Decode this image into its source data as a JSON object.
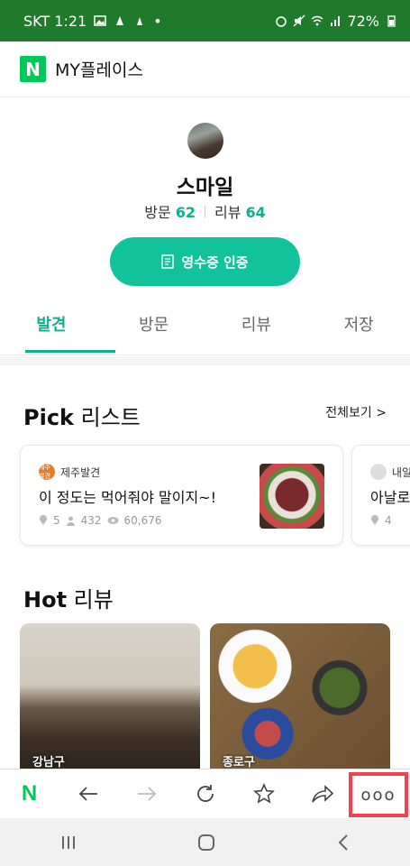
{
  "status_bar": {
    "carrier_time": "SKT 1:21",
    "battery": "72%"
  },
  "header": {
    "logo": "N",
    "title": "MY플레이스"
  },
  "profile": {
    "name": "스마일",
    "visits_label": "방문",
    "visits_count": "62",
    "reviews_label": "리뷰",
    "reviews_count": "64",
    "receipt_button": "영수증 인증"
  },
  "tabs": [
    {
      "label": "발견",
      "active": true
    },
    {
      "label": "방문",
      "active": false
    },
    {
      "label": "리뷰",
      "active": false
    },
    {
      "label": "저장",
      "active": false
    }
  ],
  "pick": {
    "title_bold": "Pick",
    "title_rest": " 리스트",
    "see_all": "전체보기 >",
    "cards": [
      {
        "source": "제주발견",
        "source_badge": "제주발견",
        "title": "이 정도는 먹어줘야 말이지~!",
        "places": "5",
        "people": "432",
        "views": "60,676"
      },
      {
        "source": "내일",
        "title": "아날로",
        "places": "4"
      }
    ]
  },
  "hot": {
    "title_bold": "Hot",
    "title_rest": " 리뷰",
    "items": [
      {
        "location": "강남구"
      },
      {
        "location": "종로구"
      }
    ]
  },
  "toolbar": {
    "logo": "N",
    "more": "ooo"
  },
  "colors": {
    "status_bar": "#1f7a2c",
    "brand_green": "#03c75a",
    "accent_teal": "#0fae8f",
    "button_teal": "#12c29b",
    "highlight_red": "#f2424d"
  },
  "icons": [
    "n-logo",
    "back-arrow-icon",
    "forward-arrow-icon",
    "refresh-icon",
    "star-icon",
    "share-icon",
    "more-icon",
    "recent-apps-icon",
    "home-icon",
    "nav-back-icon"
  ]
}
